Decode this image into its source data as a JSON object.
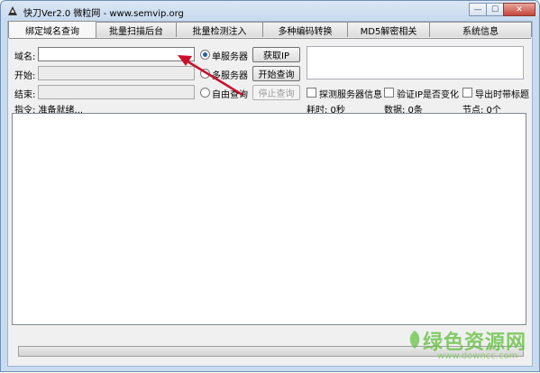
{
  "window": {
    "title": "快刀Ver2.0  微粒网 - www.semvip.org",
    "minimize_glyph": "—",
    "maximize_glyph": "☐",
    "close_glyph": "✕"
  },
  "tabs": [
    {
      "label": "绑定域名查询",
      "active": true
    },
    {
      "label": "批量扫描后台",
      "active": false
    },
    {
      "label": "批量检测注入",
      "active": false
    },
    {
      "label": "多种编码转换",
      "active": false
    },
    {
      "label": "MD5解密相关",
      "active": false
    },
    {
      "label": "系统信息",
      "active": false
    }
  ],
  "form": {
    "domain_label": "域名:",
    "domain_value": "",
    "start_label": "开始:",
    "start_value": "",
    "end_label": "结束:",
    "end_value": "",
    "radio_single": "单服务器",
    "radio_multi": "多服务器",
    "radio_free": "自由查询",
    "btn_get_ip": "获取IP",
    "btn_start": "开始查询",
    "btn_stop": "停止查询",
    "chk_probe": "探测服务器信息",
    "chk_verify_ip": "验证IP是否变化",
    "chk_export": "导出时带标题"
  },
  "status": {
    "command": "指令: 准备就绪...",
    "time": "耗时: 0秒",
    "data": "数据: 0条",
    "nodes": "节点: 0个"
  },
  "log": {
    "content": ""
  },
  "progress": {
    "value": 0
  },
  "watermark": {
    "text": "绿色资源网",
    "url": "www.downcc.com"
  },
  "colors": {
    "accent": "#2361a6",
    "arrow": "#c8102e",
    "watermark": "#5fbf3a"
  }
}
